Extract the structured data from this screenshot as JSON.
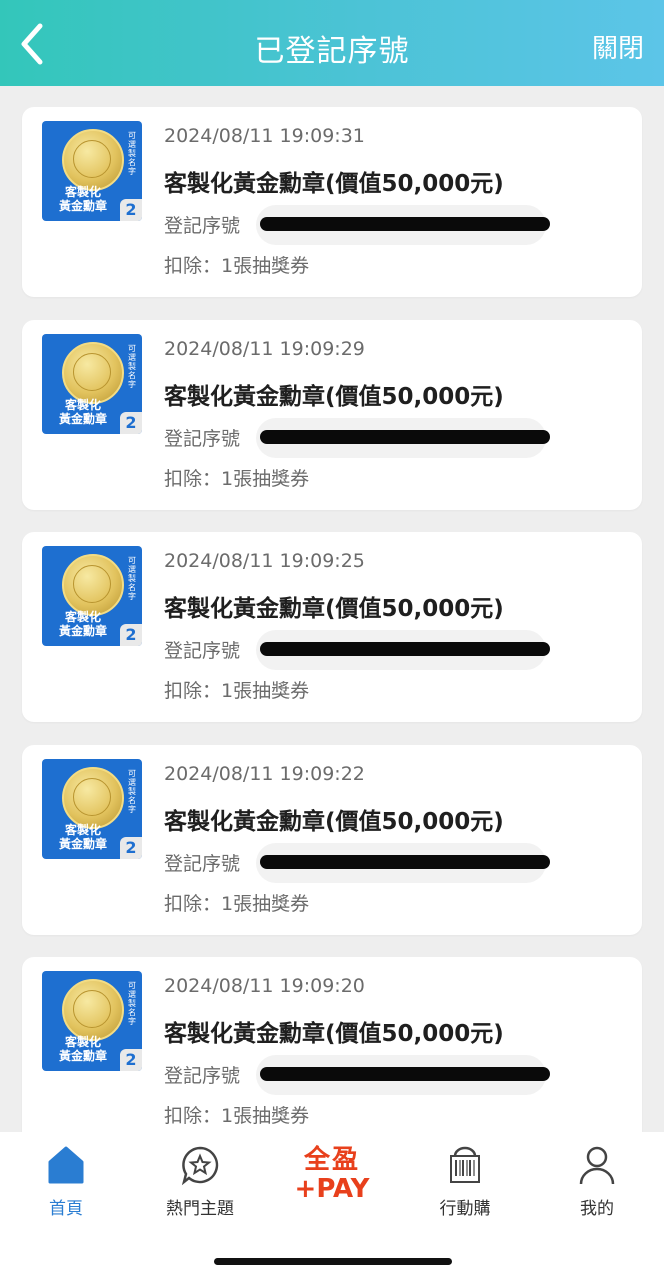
{
  "header": {
    "title": "已登記序號",
    "close_label": "關閉"
  },
  "records": [
    {
      "timestamp": "2024/08/11 19:09:31",
      "product": "客製化黃金勳章(價值50,000元)",
      "serial_label": "登記序號",
      "deduct": "扣除：1張抽獎券"
    },
    {
      "timestamp": "2024/08/11 19:09:29",
      "product": "客製化黃金勳章(價值50,000元)",
      "serial_label": "登記序號",
      "deduct": "扣除：1張抽獎券"
    },
    {
      "timestamp": "2024/08/11 19:09:25",
      "product": "客製化黃金勳章(價值50,000元)",
      "serial_label": "登記序號",
      "deduct": "扣除：1張抽獎券"
    },
    {
      "timestamp": "2024/08/11 19:09:22",
      "product": "客製化黃金勳章(價值50,000元)",
      "serial_label": "登記序號",
      "deduct": "扣除：1張抽獎券"
    },
    {
      "timestamp": "2024/08/11 19:09:20",
      "product": "客製化黃金勳章(價值50,000元)",
      "serial_label": "登記序號",
      "deduct": "扣除：1張抽獎券"
    }
  ],
  "thumbnail": {
    "label_line1": "客製化",
    "label_line2": "黃金勳章",
    "corner": "2",
    "side_text": "可選製名字"
  },
  "nav": {
    "home": "首頁",
    "hot": "熱門主題",
    "pay_top": "全盈",
    "pay_bottom": "+PAY",
    "mobile": "行動購",
    "mine": "我的"
  },
  "colors": {
    "header_start": "#33c6ba",
    "header_end": "#5cc5e8",
    "nav_active": "#2a7dd2",
    "pay_brand": "#e8401c",
    "thumb_bg": "#1e6fd0"
  }
}
